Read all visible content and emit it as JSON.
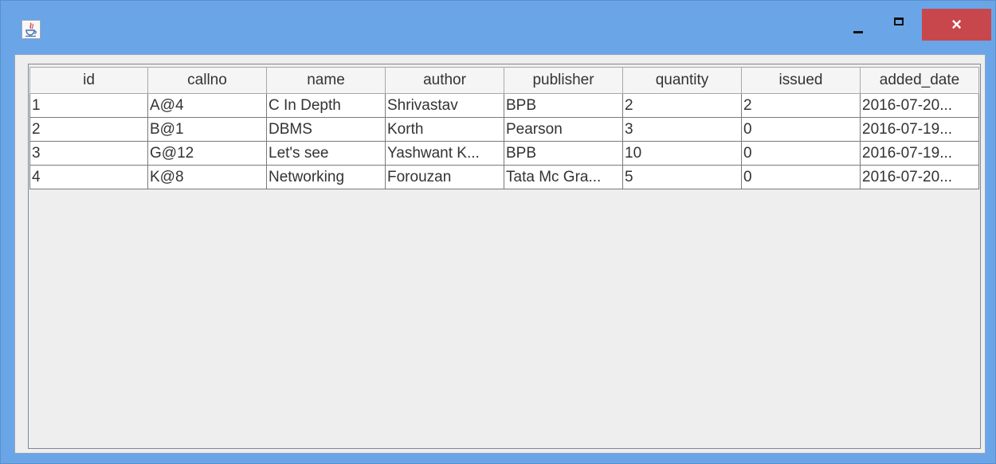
{
  "window": {
    "title": "",
    "app_icon": "java-icon",
    "controls": {
      "minimize": "minimize-icon",
      "maximize": "maximize-icon",
      "close": "×"
    },
    "colors": {
      "frame": "#6aa5e8",
      "close_button": "#c8474c"
    }
  },
  "table": {
    "columns": [
      "id",
      "callno",
      "name",
      "author",
      "publisher",
      "quantity",
      "issued",
      "added_date"
    ],
    "rows": [
      [
        "1",
        "A@4",
        "C In Depth",
        "Shrivastav",
        "BPB",
        "2",
        "2",
        "2016-07-20..."
      ],
      [
        "2",
        "B@1",
        "DBMS",
        "Korth",
        "Pearson",
        "3",
        "0",
        "2016-07-19..."
      ],
      [
        "3",
        "G@12",
        "Let's see",
        "Yashwant K...",
        "BPB",
        "10",
        "0",
        "2016-07-19..."
      ],
      [
        "4",
        "K@8",
        "Networking",
        "Forouzan",
        "Tata Mc Gra...",
        "5",
        "0",
        "2016-07-20..."
      ]
    ]
  }
}
